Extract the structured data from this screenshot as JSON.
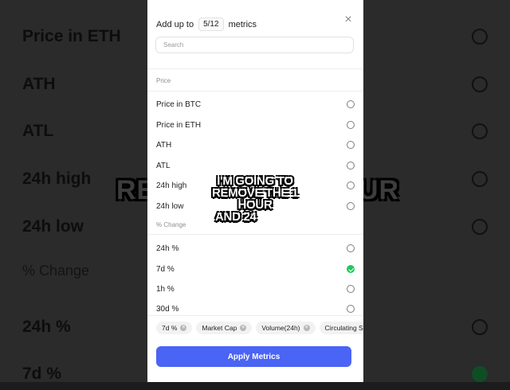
{
  "background": {
    "items": [
      {
        "label": "Price in ETH",
        "checked": false
      },
      {
        "label": "ATH",
        "checked": false
      },
      {
        "label": "ATL",
        "checked": false
      },
      {
        "label": "24h high",
        "checked": false
      },
      {
        "label": "24h low",
        "checked": false
      },
      {
        "label": "% Change",
        "section": true
      },
      {
        "label": "24h %",
        "checked": false
      },
      {
        "label": "7d %",
        "checked": true
      }
    ],
    "caption_left": "RE",
    "caption_right": "UR"
  },
  "dialog": {
    "header_prefix": "Add up to",
    "count": "5/12",
    "header_suffix": "metrics",
    "close_icon": "×",
    "search_placeholder": "Search",
    "sections": [
      {
        "title": "Price",
        "items": [
          {
            "label": "Price in BTC",
            "checked": false
          },
          {
            "label": "Price in ETH",
            "checked": false
          },
          {
            "label": "ATH",
            "checked": false
          },
          {
            "label": "ATL",
            "checked": false
          },
          {
            "label": "24h high",
            "checked": false
          },
          {
            "label": "24h low",
            "checked": false
          }
        ]
      },
      {
        "title": "% Change",
        "items": [
          {
            "label": "24h %",
            "checked": false
          },
          {
            "label": "7d %",
            "checked": true
          },
          {
            "label": "1h %",
            "checked": false
          },
          {
            "label": "30d %",
            "checked": false
          }
        ]
      }
    ],
    "chips": [
      "7d %",
      "Market Cap",
      "Volume(24h)",
      "Circulating Su"
    ],
    "apply_label": "Apply Metrics"
  },
  "caption": {
    "lines": [
      "I'M GOING TO",
      "REMOVE THE 1 HOUR",
      "AND 24"
    ]
  },
  "colors": {
    "accent": "#4a64f5",
    "checked": "#22c55e"
  }
}
